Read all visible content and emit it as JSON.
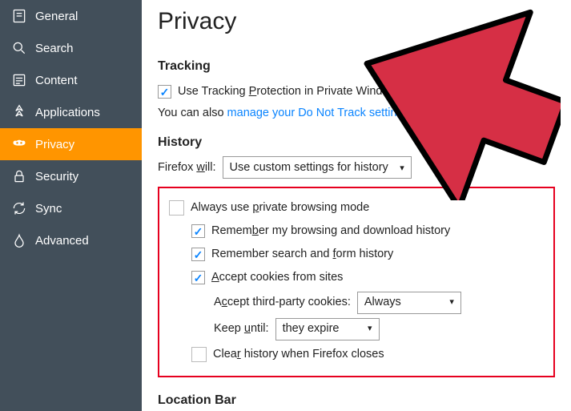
{
  "sidebar": {
    "items": [
      {
        "label": "General"
      },
      {
        "label": "Search"
      },
      {
        "label": "Content"
      },
      {
        "label": "Applications"
      },
      {
        "label": "Privacy"
      },
      {
        "label": "Security"
      },
      {
        "label": "Sync"
      },
      {
        "label": "Advanced"
      }
    ]
  },
  "page": {
    "title": "Privacy"
  },
  "tracking": {
    "heading": "Tracking",
    "checkbox_label_pre": "Use Tracking ",
    "checkbox_label_u": "P",
    "checkbox_label_post": "rotection in Private Windows",
    "hint_pre": "You can also ",
    "hint_link": "manage your Do Not Track settings",
    "hint_post": "."
  },
  "history": {
    "heading": "History",
    "will_label_pre": "Firefox ",
    "will_label_u": "w",
    "will_label_post": "ill:",
    "will_select": "Use custom settings for history",
    "private_pre": "Always use ",
    "private_u": "p",
    "private_post": "rivate browsing mode",
    "remember_browse_pre": "Remem",
    "remember_browse_u": "b",
    "remember_browse_post": "er my browsing and download history",
    "remember_form_pre": "Remember search and ",
    "remember_form_u": "f",
    "remember_form_post": "orm history",
    "accept_cookies_u": "A",
    "accept_cookies_post": "ccept cookies from sites",
    "third_party_label_pre": "A",
    "third_party_label_u": "c",
    "third_party_label_post": "cept third-party cookies:",
    "third_party_select": "Always",
    "keep_label_pre": "Keep ",
    "keep_label_u": "u",
    "keep_label_post": "ntil:",
    "keep_select": "they expire",
    "clear_pre": "Clea",
    "clear_u": "r",
    "clear_post": " history when Firefox closes"
  },
  "location": {
    "heading": "Location Bar"
  }
}
